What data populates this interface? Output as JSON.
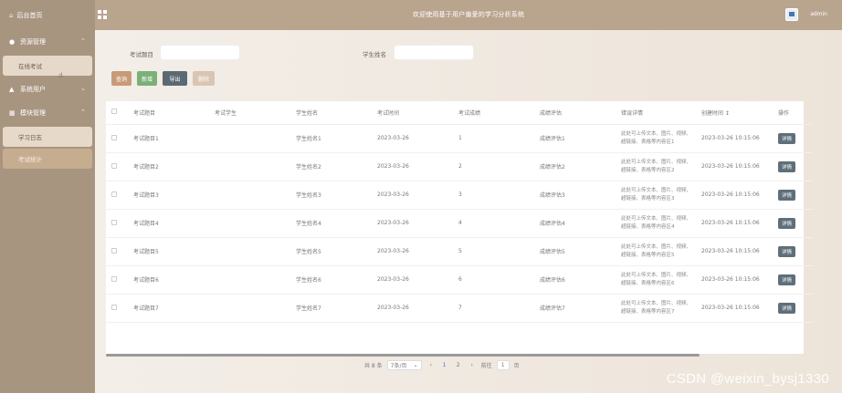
{
  "topbar": {
    "brand": "后台首页",
    "welcome": "欢迎使用基于用户偏爱的学习分析系统",
    "user": "admin"
  },
  "sidebar": {
    "groups": [
      {
        "label": "资源管理",
        "items": [
          "在线考试"
        ]
      },
      {
        "label": "系统用户",
        "items": []
      },
      {
        "label": "模块管理",
        "items": [
          "学习日志",
          "考试统计"
        ]
      }
    ]
  },
  "search": {
    "field1_label": "考试题目",
    "field1_placeholder": "",
    "field2_label": "学生姓名",
    "field2_placeholder": ""
  },
  "buttons": {
    "search": "查询",
    "add": "新增",
    "export": "导出",
    "delete": "删除"
  },
  "table": {
    "headers": [
      "",
      "考试题目",
      "考试学生",
      "学生姓名",
      "考试时间",
      "考试成绩",
      "成绩评估",
      "错误详情",
      "创建时间 ↕",
      "操作"
    ],
    "rows": [
      {
        "title": "考试题目1",
        "student": "",
        "name": "学生姓名1",
        "time": "2023-03-26",
        "score": "1",
        "eval": "成绩评估1",
        "detail": "此处可上传文本、图片、视频、超链接、表格等内容区1",
        "created": "2023-03-26 10:15:06",
        "op": "详情"
      },
      {
        "title": "考试题目2",
        "student": "",
        "name": "学生姓名2",
        "time": "2023-03-26",
        "score": "2",
        "eval": "成绩评估2",
        "detail": "此处可上传文本、图片、视频、超链接、表格等内容区2",
        "created": "2023-03-26 10:15:06",
        "op": "详情"
      },
      {
        "title": "考试题目3",
        "student": "",
        "name": "学生姓名3",
        "time": "2023-03-26",
        "score": "3",
        "eval": "成绩评估3",
        "detail": "此处可上传文本、图片、视频、超链接、表格等内容区3",
        "created": "2023-03-26 10:15:06",
        "op": "详情"
      },
      {
        "title": "考试题目4",
        "student": "",
        "name": "学生姓名4",
        "time": "2023-03-26",
        "score": "4",
        "eval": "成绩评估4",
        "detail": "此处可上传文本、图片、视频、超链接、表格等内容区4",
        "created": "2023-03-26 10:15:06",
        "op": "详情"
      },
      {
        "title": "考试题目5",
        "student": "",
        "name": "学生姓名5",
        "time": "2023-03-26",
        "score": "5",
        "eval": "成绩评估5",
        "detail": "此处可上传文本、图片、视频、超链接、表格等内容区5",
        "created": "2023-03-26 10:15:06",
        "op": "详情"
      },
      {
        "title": "考试题目6",
        "student": "",
        "name": "学生姓名6",
        "time": "2023-03-26",
        "score": "6",
        "eval": "成绩评估6",
        "detail": "此处可上传文本、图片、视频、超链接、表格等内容区6",
        "created": "2023-03-26 10:15:06",
        "op": "详情"
      },
      {
        "title": "考试题目7",
        "student": "",
        "name": "学生姓名7",
        "time": "2023-03-26",
        "score": "7",
        "eval": "成绩评估7",
        "detail": "此处可上传文本、图片、视频、超链接、表格等内容区7",
        "created": "2023-03-26 10:15:06",
        "op": "详情"
      }
    ]
  },
  "pagination": {
    "total": "共 8 条",
    "page_size": "7条/页",
    "pages": [
      "1",
      "2"
    ],
    "current": "1",
    "goto_label": "前往",
    "goto_value": "1",
    "goto_suffix": "页"
  },
  "watermark": "CSDN @weixin_bysj1330"
}
